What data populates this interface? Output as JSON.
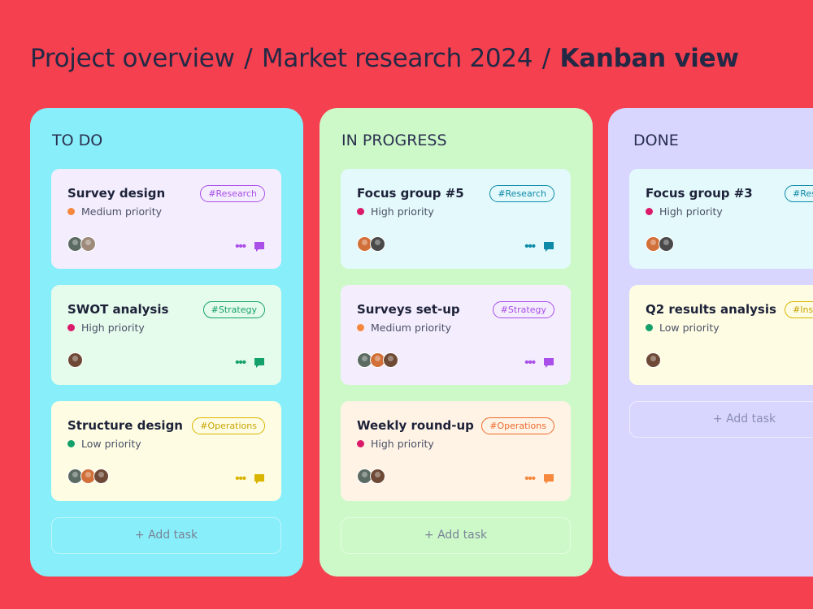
{
  "breadcrumb": {
    "items": [
      "Project overview",
      "Market research 2024"
    ],
    "current": "Kanban view",
    "separator": "/"
  },
  "colors": {
    "background": "#f5404f",
    "todo": "#88eefa",
    "in_progress": "#cdf9c9",
    "done": "#d8d5fe",
    "medium": "#f6883e",
    "high": "#db1a6a",
    "low": "#14a06b"
  },
  "columns": [
    {
      "title": "TO DO",
      "add_label": "+ Add task",
      "cards": [
        {
          "title": "Survey design",
          "tag": "#Research",
          "priority": "Medium priority"
        },
        {
          "title": "SWOT analysis",
          "tag": "#Strategy",
          "priority": "High priority"
        },
        {
          "title": "Structure design",
          "tag": "#Operations",
          "priority": "Low priority"
        }
      ]
    },
    {
      "title": "IN PROGRESS",
      "add_label": "+ Add task",
      "cards": [
        {
          "title": "Focus group #5",
          "tag": "#Research",
          "priority": "High priority"
        },
        {
          "title": "Surveys set-up",
          "tag": "#Strategy",
          "priority": "Medium priority"
        },
        {
          "title": "Weekly round-up",
          "tag": "#Operations",
          "priority": "High priority"
        }
      ]
    },
    {
      "title": "DONE",
      "add_label": "+ Add task",
      "cards": [
        {
          "title": "Focus group #3",
          "tag": "#Rese",
          "priority": "High priority"
        },
        {
          "title": "Q2 results analysis",
          "tag": "#Ins",
          "priority": "Low priority"
        }
      ]
    }
  ],
  "icons": {
    "more": "more-dots-icon",
    "comment": "comment-bubble-icon"
  }
}
